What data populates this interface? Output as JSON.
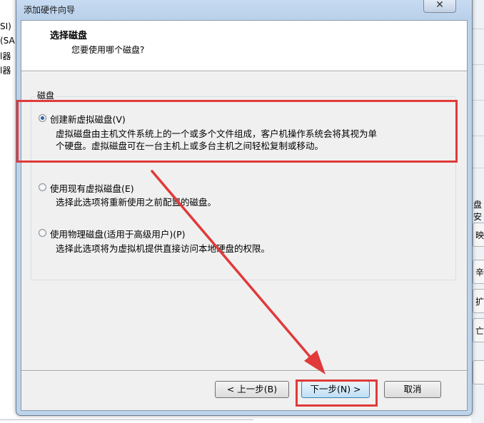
{
  "background": {
    "left_fragments": [
      "SI)",
      "(SA",
      "l器",
      "l器"
    ],
    "right_fragments": [
      "盘安",
      "映",
      "辛片",
      "扩",
      "亡"
    ]
  },
  "dialog": {
    "title": "添加硬件向导",
    "close_glyph": "✕",
    "header": {
      "title": "选择磁盘",
      "subtitle": "您要使用哪个磁盘?"
    },
    "group_label": "磁盘",
    "options": [
      {
        "label": "创建新虚拟磁盘(V)",
        "selected": true,
        "desc_line1": "虚拟磁盘由主机文件系统上的一个或多个文件组成，客户机操作系统会将其视为单",
        "desc_line2": "个硬盘。虚拟磁盘可在一台主机上或多台主机之间轻松复制或移动。"
      },
      {
        "label": "使用现有虚拟磁盘(E)",
        "selected": false,
        "desc_line1": "选择此选项将重新使用之前配置的磁盘。"
      },
      {
        "label": "使用物理磁盘(适用于高级用户)(P)",
        "selected": false,
        "desc_line1": "选择此选项将为虚拟机提供直接访问本地硬盘的权限。"
      }
    ],
    "buttons": {
      "back": "< 上一步(B)",
      "next": "下一步(N) >",
      "cancel": "取消"
    }
  },
  "annotations": {
    "highlight_color": "#e03a3a"
  }
}
